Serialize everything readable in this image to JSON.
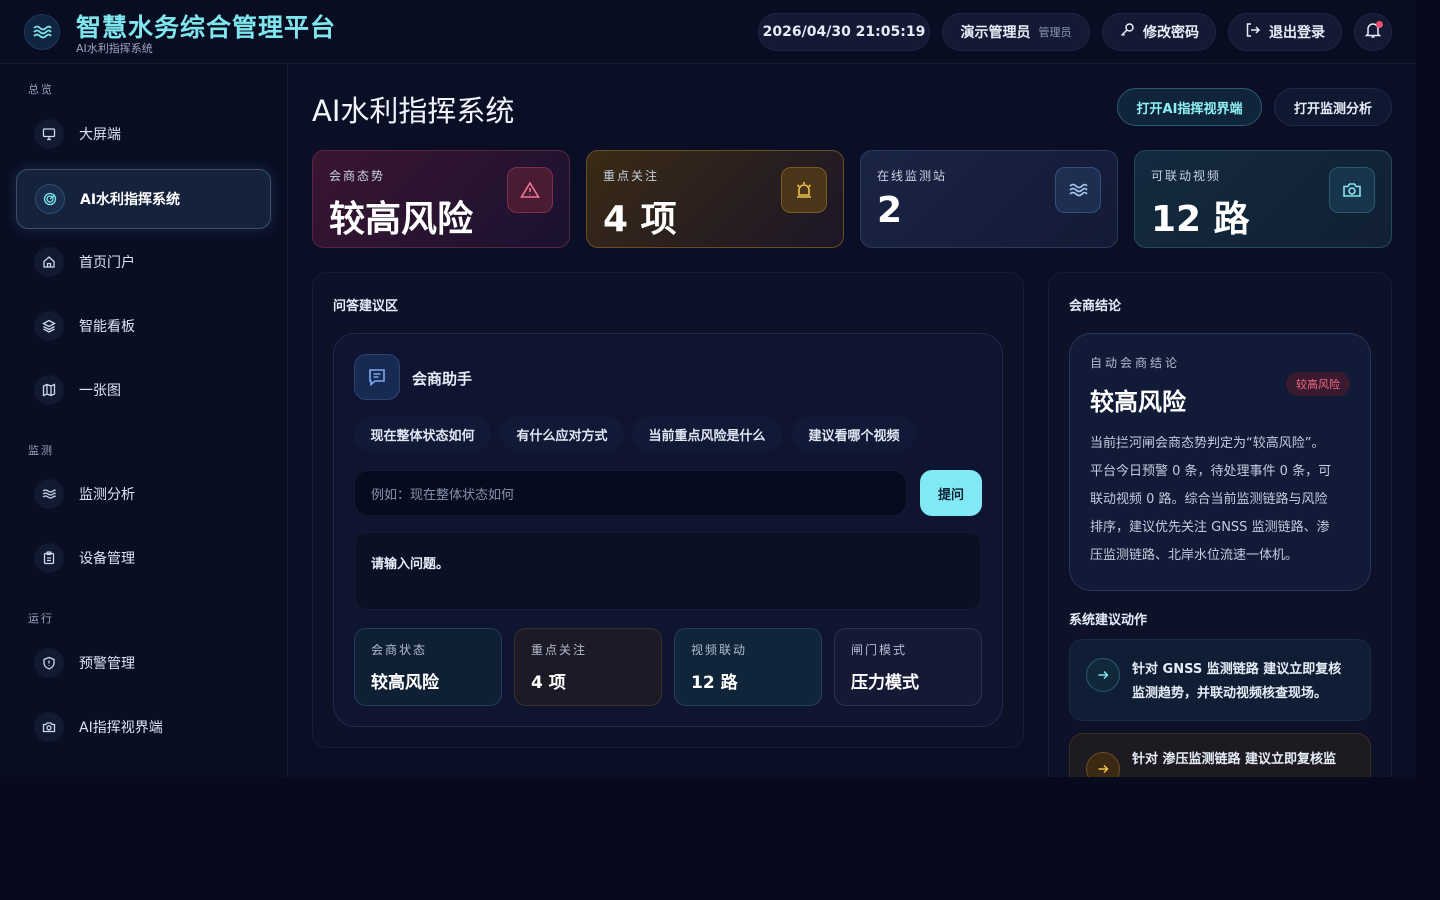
{
  "header": {
    "title": "智慧水务综合管理平台",
    "subtitle": "AI水利指挥系统",
    "datetime": "2026/04/30 21:05:19",
    "user_name": "演示管理员",
    "user_role": "管理员",
    "change_password": "修改密码",
    "logout": "退出登录"
  },
  "sidebar": {
    "sections": [
      {
        "label": "总览"
      },
      {
        "label": "监测"
      },
      {
        "label": "运行"
      }
    ],
    "items": [
      {
        "label": "大屏端",
        "icon": "monitor-icon"
      },
      {
        "label": "AI水利指挥系统",
        "icon": "radar-icon",
        "active": true
      },
      {
        "label": "首页门户",
        "icon": "home-icon"
      },
      {
        "label": "智能看板",
        "icon": "layers-icon"
      },
      {
        "label": "一张图",
        "icon": "map-icon"
      },
      {
        "label": "监测分析",
        "icon": "waves-icon"
      },
      {
        "label": "设备管理",
        "icon": "clipboard-icon"
      },
      {
        "label": "预警管理",
        "icon": "shield-icon"
      },
      {
        "label": "AI指挥视界端",
        "icon": "camera-icon"
      }
    ]
  },
  "page": {
    "title": "AI水利指挥系统",
    "open_ai_view": "打开AI指挥视界端",
    "open_monitor": "打开监测分析"
  },
  "cards": [
    {
      "label": "会商态势",
      "value": "较高风险",
      "icon": "warning-icon",
      "color": "#e0607a"
    },
    {
      "label": "重点关注",
      "value": "4 项",
      "icon": "alarm-icon",
      "color": "#e8b44a"
    },
    {
      "label": "在线监测站",
      "value": "2",
      "icon": "waves-icon",
      "color": "#7fb4e8"
    },
    {
      "label": "可联动视频",
      "value": "12 路",
      "icon": "camera-icon",
      "color": "#6fd4e6"
    }
  ],
  "qa": {
    "title": "问答建议区",
    "assistant": "会商助手",
    "chips": [
      "现在整体状态如何",
      "有什么应对方式",
      "当前重点风险是什么",
      "建议看哪个视频"
    ],
    "placeholder": "例如：现在整体状态如何",
    "submit": "提问",
    "answer": "请输入问题。",
    "stats": [
      {
        "label": "会商状态",
        "value": "较高风险"
      },
      {
        "label": "重点关注",
        "value": "4 项"
      },
      {
        "label": "视频联动",
        "value": "12 路"
      },
      {
        "label": "闸门模式",
        "value": "压力模式"
      }
    ]
  },
  "conclusion": {
    "title": "会商结论",
    "auto_label": "自动会商结论",
    "risk": "较高风险",
    "badge": "较高风险",
    "lines": [
      "当前拦河闸会商态势判定为“较高风险”。",
      "平台今日预警 0 条，待处理事件 0 条，可",
      "联动视频 0 路。综合当前监测链路与风险",
      "排序，建议优先关注 GNSS 监测链路、渗",
      "压监测链路、北岸水位流速一体机。"
    ],
    "actions_title": "系统建议动作",
    "actions": [
      {
        "lines": [
          "针对 GNSS 监测链路 建议立即复核",
          "监测趋势，并联动视频核查现场。"
        ]
      },
      {
        "lines": [
          "针对 渗压监测链路 建议立即复核监"
        ]
      }
    ]
  }
}
